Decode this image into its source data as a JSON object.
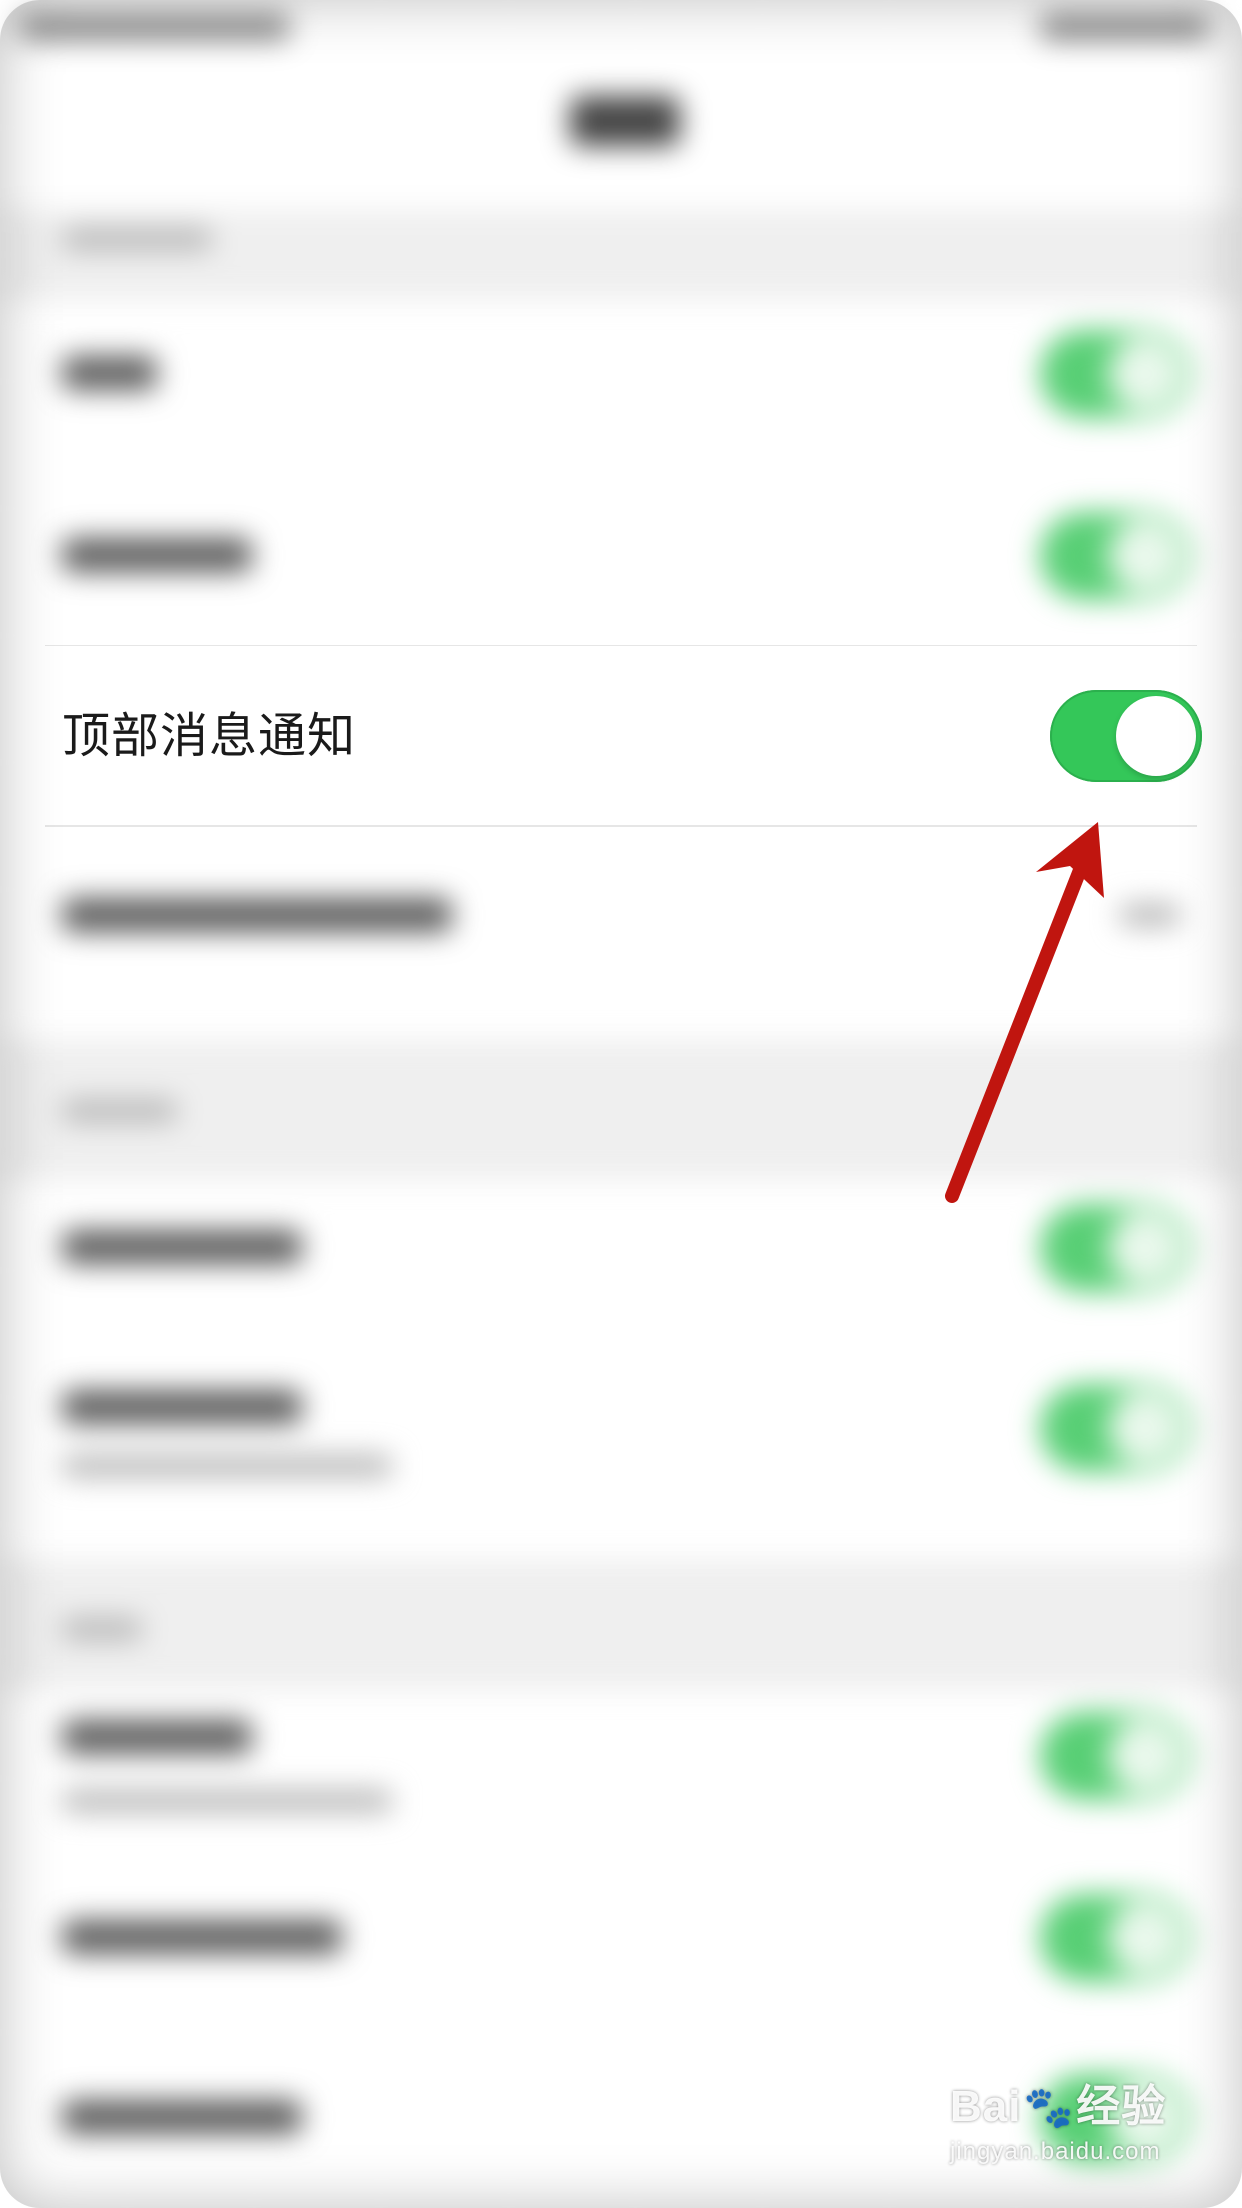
{
  "settings": {
    "top_notification": {
      "label": "顶部消息通知",
      "enabled": true
    }
  },
  "colors": {
    "toggle_on": "#34c759",
    "arrow": "#c0150f"
  },
  "icons": {
    "annotation": "red-arrow-icon",
    "watermark_paw": "paw-icon"
  },
  "watermark": {
    "logo_prefix": "Bai",
    "logo_suffix": "经验",
    "url": "jingyan.baidu.com"
  }
}
